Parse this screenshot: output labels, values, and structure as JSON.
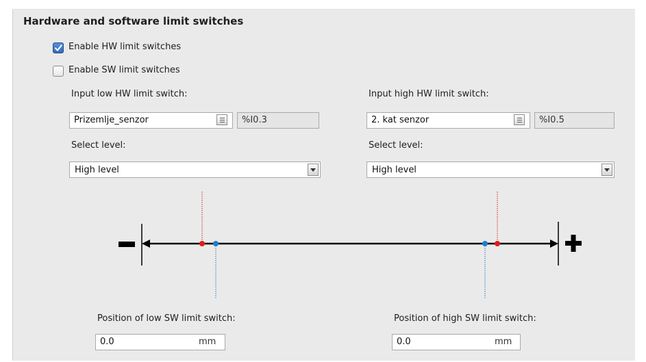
{
  "section": {
    "title": "Hardware and software limit switches"
  },
  "hw_enable": {
    "label": "Enable HW limit switches",
    "checked": true
  },
  "sw_enable": {
    "label": "Enable SW limit switches",
    "checked": false
  },
  "low_hw": {
    "label": "Input low HW limit switch:",
    "tag": "Prizemlje_senzor",
    "address": "%I0.3",
    "level_label": "Select level:",
    "level_value": "High level"
  },
  "high_hw": {
    "label": "Input high HW limit switch:",
    "tag": "2. kat senzor",
    "address": "%I0.5",
    "level_label": "Select level:",
    "level_value": "High level"
  },
  "diagram": {
    "colors": {
      "hw_marker": "#e21b1b",
      "sw_marker": "#1e7fc9",
      "axis": "#000000"
    }
  },
  "low_sw": {
    "label": "Position of low SW limit switch:",
    "value": "0.0",
    "unit": "mm"
  },
  "high_sw": {
    "label": "Position of high SW limit switch:",
    "value": "0.0",
    "unit": "mm"
  }
}
